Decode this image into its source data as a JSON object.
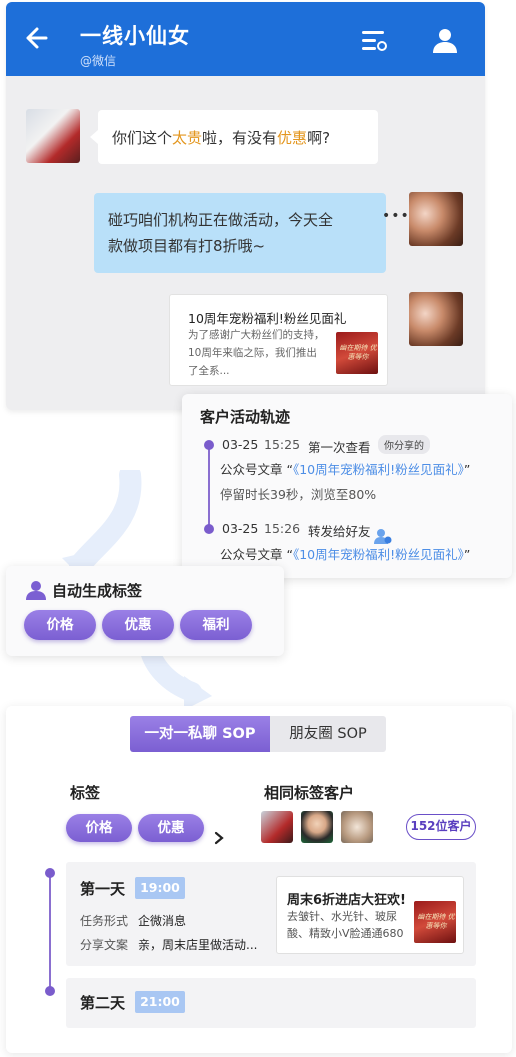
{
  "chat": {
    "title": "一线小仙女",
    "subtitle": "@微信",
    "icons": {
      "back": "back-arrow-icon",
      "filter": "filter-icon",
      "user": "user-icon"
    },
    "msg_left": {
      "pre": "你们这个",
      "hl1": "太贵",
      "mid": "啦，有没有",
      "hl2": "优惠",
      "post": "啊?"
    },
    "msg_right_line1": "碰巧咱们机构正在做活动，今天全",
    "msg_right_line2": "款做项目都有打8折哦~",
    "more": "•••",
    "link_card": {
      "title": "10周年宠粉福利!粉丝见面礼",
      "desc_line1": "为了感谢广大粉丝们的支持，",
      "desc_line2": "10周年来临之际，我们推出",
      "desc_line3": "了全系...",
      "thumb_text": "幽在期待 优惠等你"
    }
  },
  "track": {
    "title": "客户活动轨迹",
    "e1": {
      "date": "03-25",
      "time": "15:25",
      "action": "第一次查看",
      "badge": "你分享的"
    },
    "e1_article_prefix": "公众号文章 “",
    "e1_article_link": "《10周年宠粉福利!粉丝见面礼》",
    "e1_article_suffix": "”",
    "e1_stay": "停留时长39秒，浏览至80%",
    "e2": {
      "date": "03-25",
      "time": "15:26",
      "action": "转发给好友"
    },
    "e2_article_prefix": "公众号文章 “",
    "e2_article_link": "《10周年宠粉福利!粉丝见面礼》",
    "e2_article_suffix": "”"
  },
  "auto_tags": {
    "title": "自动生成标签",
    "tags": [
      "价格",
      "优惠",
      "福利"
    ]
  },
  "sop": {
    "tabs": [
      "一对一私聊 SOP",
      "朋友圈 SOP"
    ],
    "active_tab": 0,
    "tag_label": "标签",
    "same_label": "相同标签客户",
    "tags": [
      "价格",
      "优惠"
    ],
    "count": "152位客户",
    "day1": {
      "name": "第一天",
      "time": "19:00",
      "form_k": "任务形式",
      "form_v": "企微消息",
      "copy_k": "分享文案",
      "copy_v": "亲，周末店里做活动...",
      "promo_title": "周末6折进店大狂欢!",
      "promo_desc1": "去皱针、水光针、玻尿",
      "promo_desc2": "酸、精致小V脸通通680",
      "thumb_text": "幽在期待 优惠等你"
    },
    "day2": {
      "name": "第二天",
      "time": "21:00"
    }
  },
  "colors": {
    "header_blue": "#1e6fd9",
    "accent_purple": "#7b5fd2",
    "bubble_blue": "#b9e0f9",
    "highlight": "#e3961e",
    "link": "#4d8ee6"
  }
}
